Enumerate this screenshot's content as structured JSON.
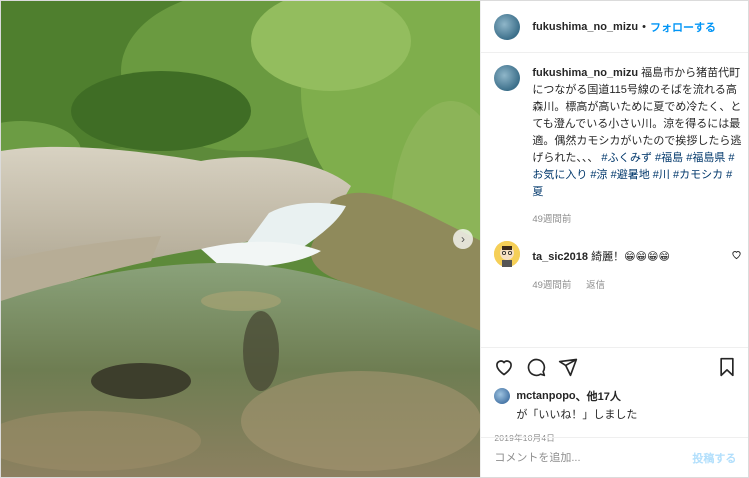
{
  "photo": {
    "alt_subject": "mountain stream",
    "next_icon": "chevron-right-icon"
  },
  "header": {
    "username": "fukushima_no_mizu",
    "separator": "•",
    "follow_label": "フォローする"
  },
  "caption": {
    "username": "fukushima_no_mizu",
    "text": "福島市から猪苗代町につながる国道115号線のそばを流れる高森川。標高が高いために夏でめ冷たく、とても澄んでいる小さい川。涼を得るには最適。偶然カモシカがいたので挨拶したら逃げられた、、、",
    "hashtags": [
      "#ふくみず",
      "#福島",
      "#福島県",
      "#お気に入り",
      "#涼",
      "#避暑地",
      "#川",
      "#カモシカ",
      "#夏"
    ],
    "time": "49週間前"
  },
  "comment": {
    "username": "ta_sic2018",
    "text": "綺麗！😁😁😁😁",
    "time": "49週間前",
    "reply_label": "返信"
  },
  "likes": {
    "user": "mctanpopo",
    "suffix": "、他17人",
    "line2": "が「いいね！」しました"
  },
  "date": "2019年10月4日",
  "composer": {
    "placeholder": "コメントを追加...",
    "post_label": "投稿する"
  },
  "colors": {
    "accent": "#0095f6",
    "hashtag": "#00376b",
    "muted": "#8e8e8e",
    "post_disabled": "#b2dffc"
  }
}
